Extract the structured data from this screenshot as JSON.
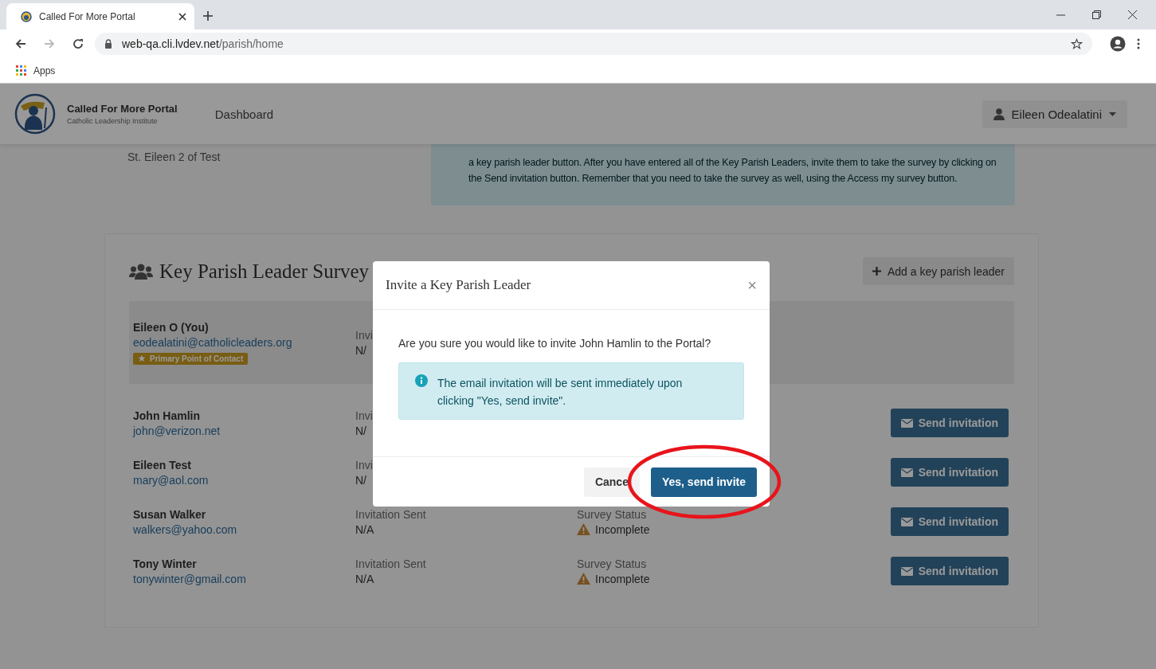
{
  "browser": {
    "tab_title": "Called For More Portal",
    "url_host": "web-qa.cli.lvdev.net",
    "url_path": "/parish/home",
    "bookmarks": [
      "Apps"
    ]
  },
  "navbar": {
    "brand_title": "Called For More Portal",
    "brand_subtitle": "Catholic Leadership Institute",
    "nav_items": [
      "Dashboard"
    ],
    "user_name": "Eileen Odealatini"
  },
  "parish": {
    "name": "St. Eileen 2 of Test"
  },
  "info_text": "a key parish leader button. After you have entered all of the Key Parish Leaders, invite them to take the survey by clicking on the Send invitation button. Remember that you need to take the survey as well, using the Access my survey button.",
  "survey": {
    "title": "Key Parish Leader Survey",
    "add_button": "Add a key parish leader",
    "leaders": [
      {
        "name": "Eileen O (You)",
        "email": "eodealatini@catholicleaders.org",
        "badge": "Primary Point of Contact",
        "featured": true,
        "invitation_label": "Invi",
        "invitation_value": "N/"
      },
      {
        "name": "John Hamlin",
        "email": "john@verizon.net",
        "featured": false,
        "invitation_label": "Invi",
        "invitation_value": "N/",
        "send_button": "Send invitation"
      },
      {
        "name": "Eileen Test",
        "email": "mary@aol.com",
        "featured": false,
        "invitation_label": "Invi",
        "invitation_value": "N/",
        "send_button": "Send invitation"
      },
      {
        "name": "Susan Walker",
        "email": "walkers@yahoo.com",
        "featured": false,
        "invitation_label": "Invitation Sent",
        "invitation_value": "N/A",
        "status_label": "Survey Status",
        "status_value": "Incomplete",
        "kind": "incomplete",
        "send_button": "Send invitation"
      },
      {
        "name": "Tony Winter",
        "email": "tonywinter@gmail.com",
        "featured": false,
        "invitation_label": "Invitation Sent",
        "invitation_value": "N/A",
        "status_label": "Survey Status",
        "status_value": "Incomplete",
        "kind": "incomplete",
        "send_button": "Send invitation"
      }
    ]
  },
  "modal": {
    "title": "Invite a Key Parish Leader",
    "close": "×",
    "question": "Are you sure you would like to invite John Hamlin to the Portal?",
    "alert": "The email invitation will be sent immediately upon clicking \"Yes, send invite\".",
    "buttons": [
      {
        "label": "Cance",
        "kind": "secondary"
      },
      {
        "label": "Yes, send invite",
        "kind": "primary"
      }
    ]
  }
}
